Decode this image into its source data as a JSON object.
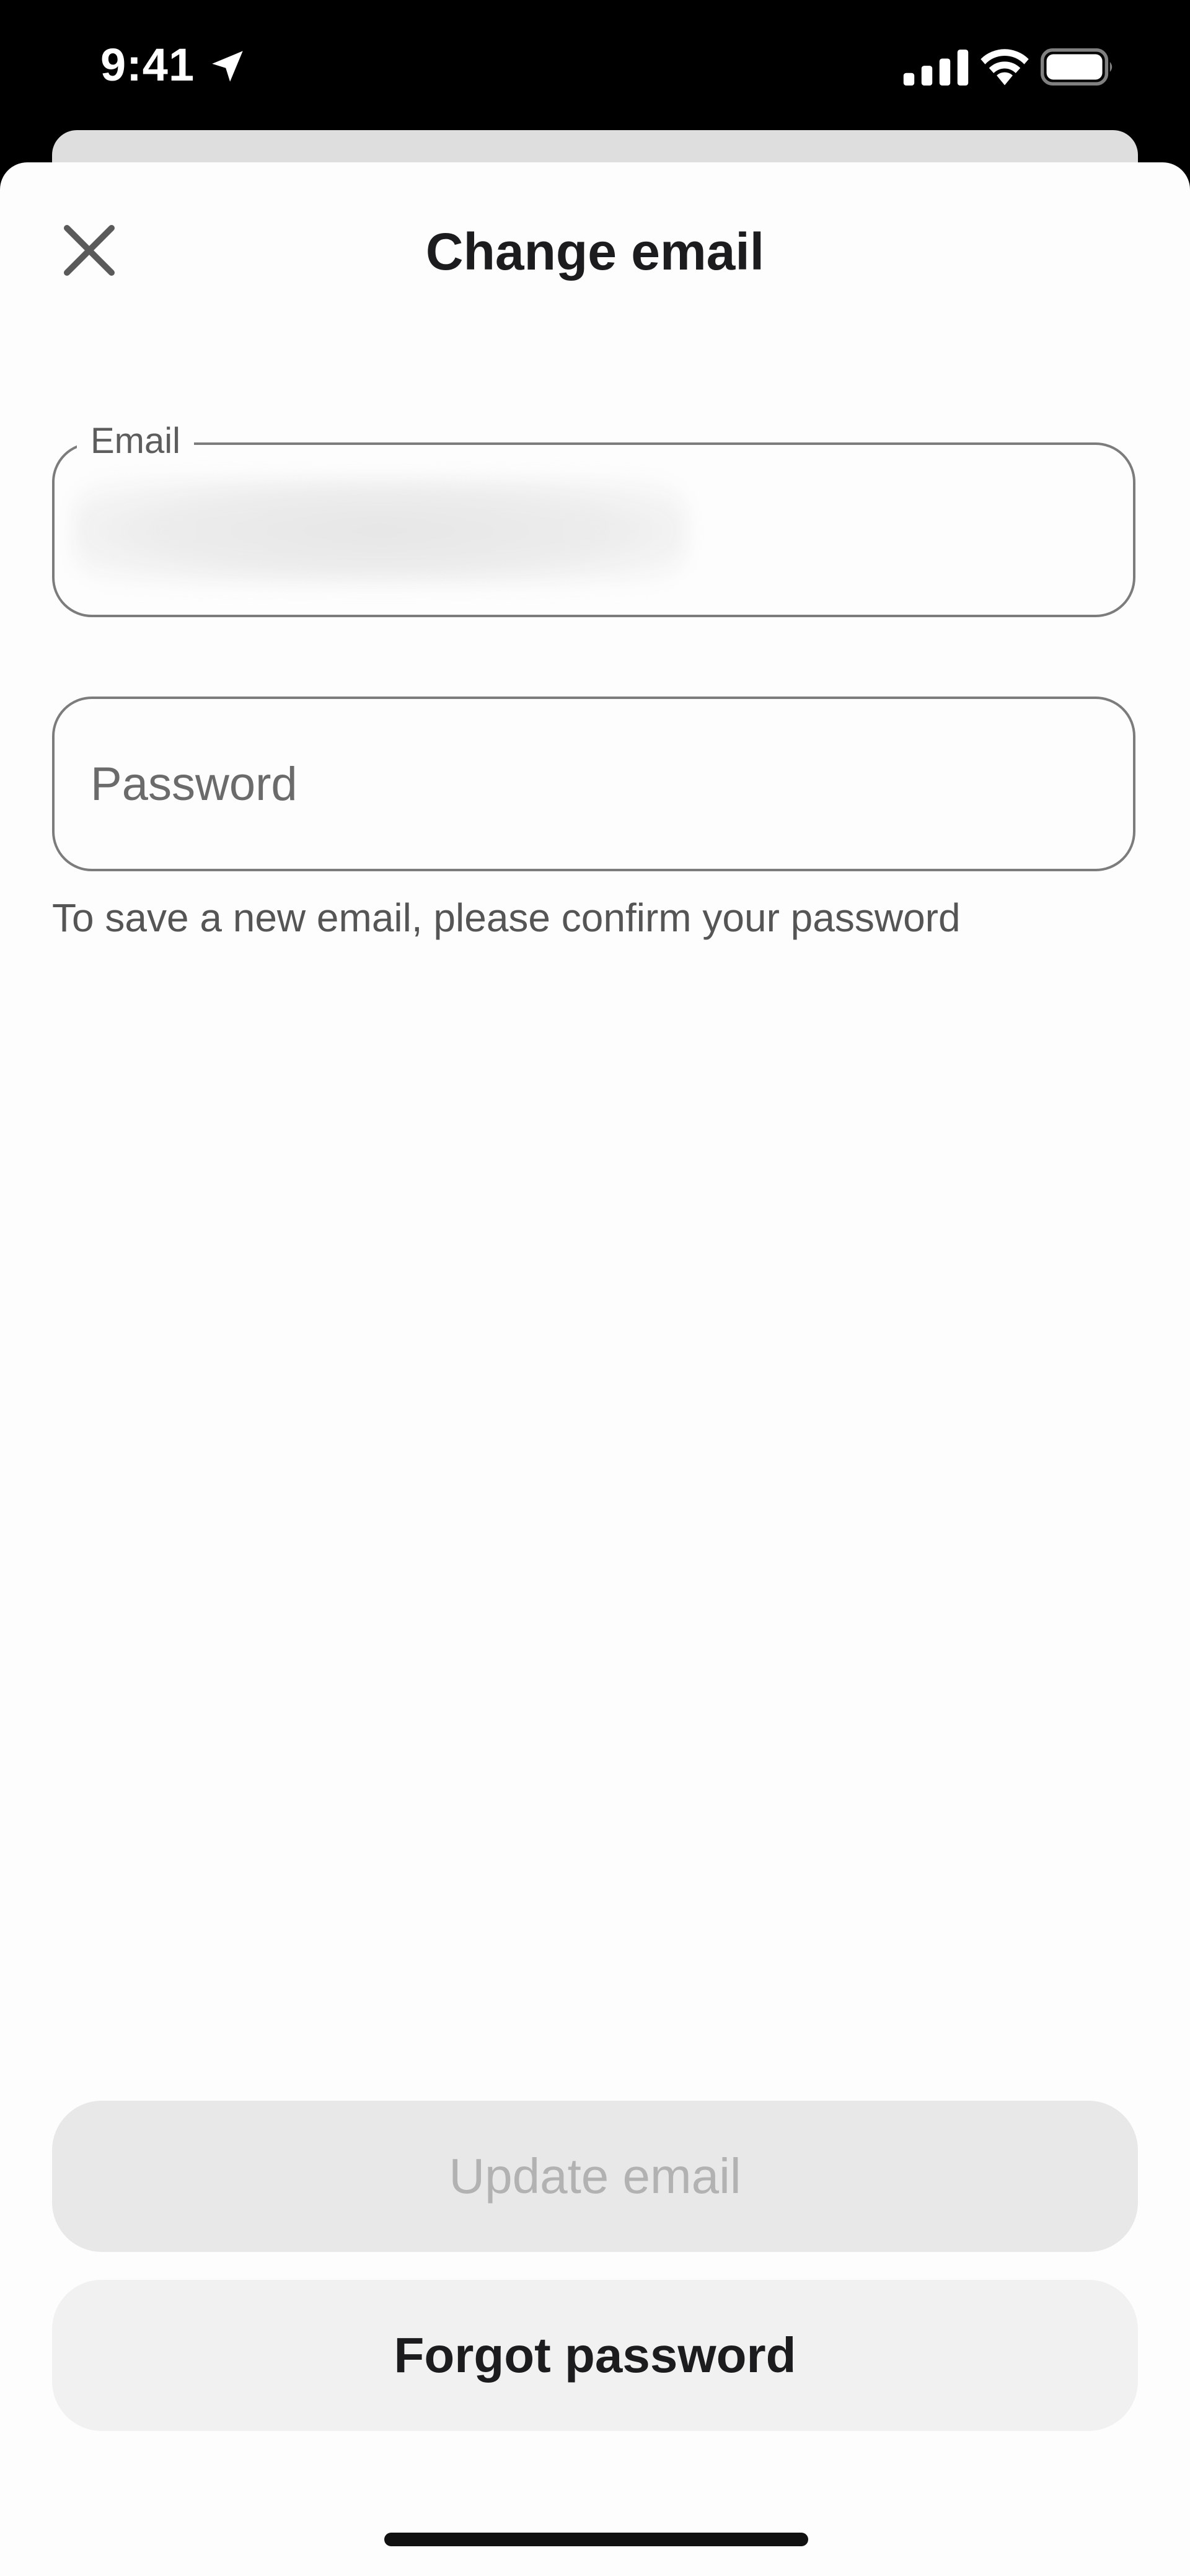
{
  "status_bar": {
    "time": "9:41",
    "location_icon": "location-arrow-icon",
    "signal_icon": "cellular-signal-icon",
    "wifi_icon": "wifi-icon",
    "battery_icon": "battery-icon"
  },
  "header": {
    "close_icon": "close-icon",
    "title": "Change email"
  },
  "form": {
    "email_label": "Email",
    "email_value": "",
    "password_placeholder": "Password",
    "password_value": "",
    "helper_text": "To save a new email, please confirm your password"
  },
  "actions": {
    "update_label": "Update email",
    "update_enabled": false,
    "forgot_label": "Forgot password"
  },
  "colors": {
    "background": "#000000",
    "sheet": "#fdfdfd",
    "field_border": "#7c7c7c",
    "disabled_button": "#e8e8e8",
    "disabled_text": "#b2b2b2",
    "secondary_button": "#f1f1f1",
    "text_primary": "#1c1c1e"
  }
}
